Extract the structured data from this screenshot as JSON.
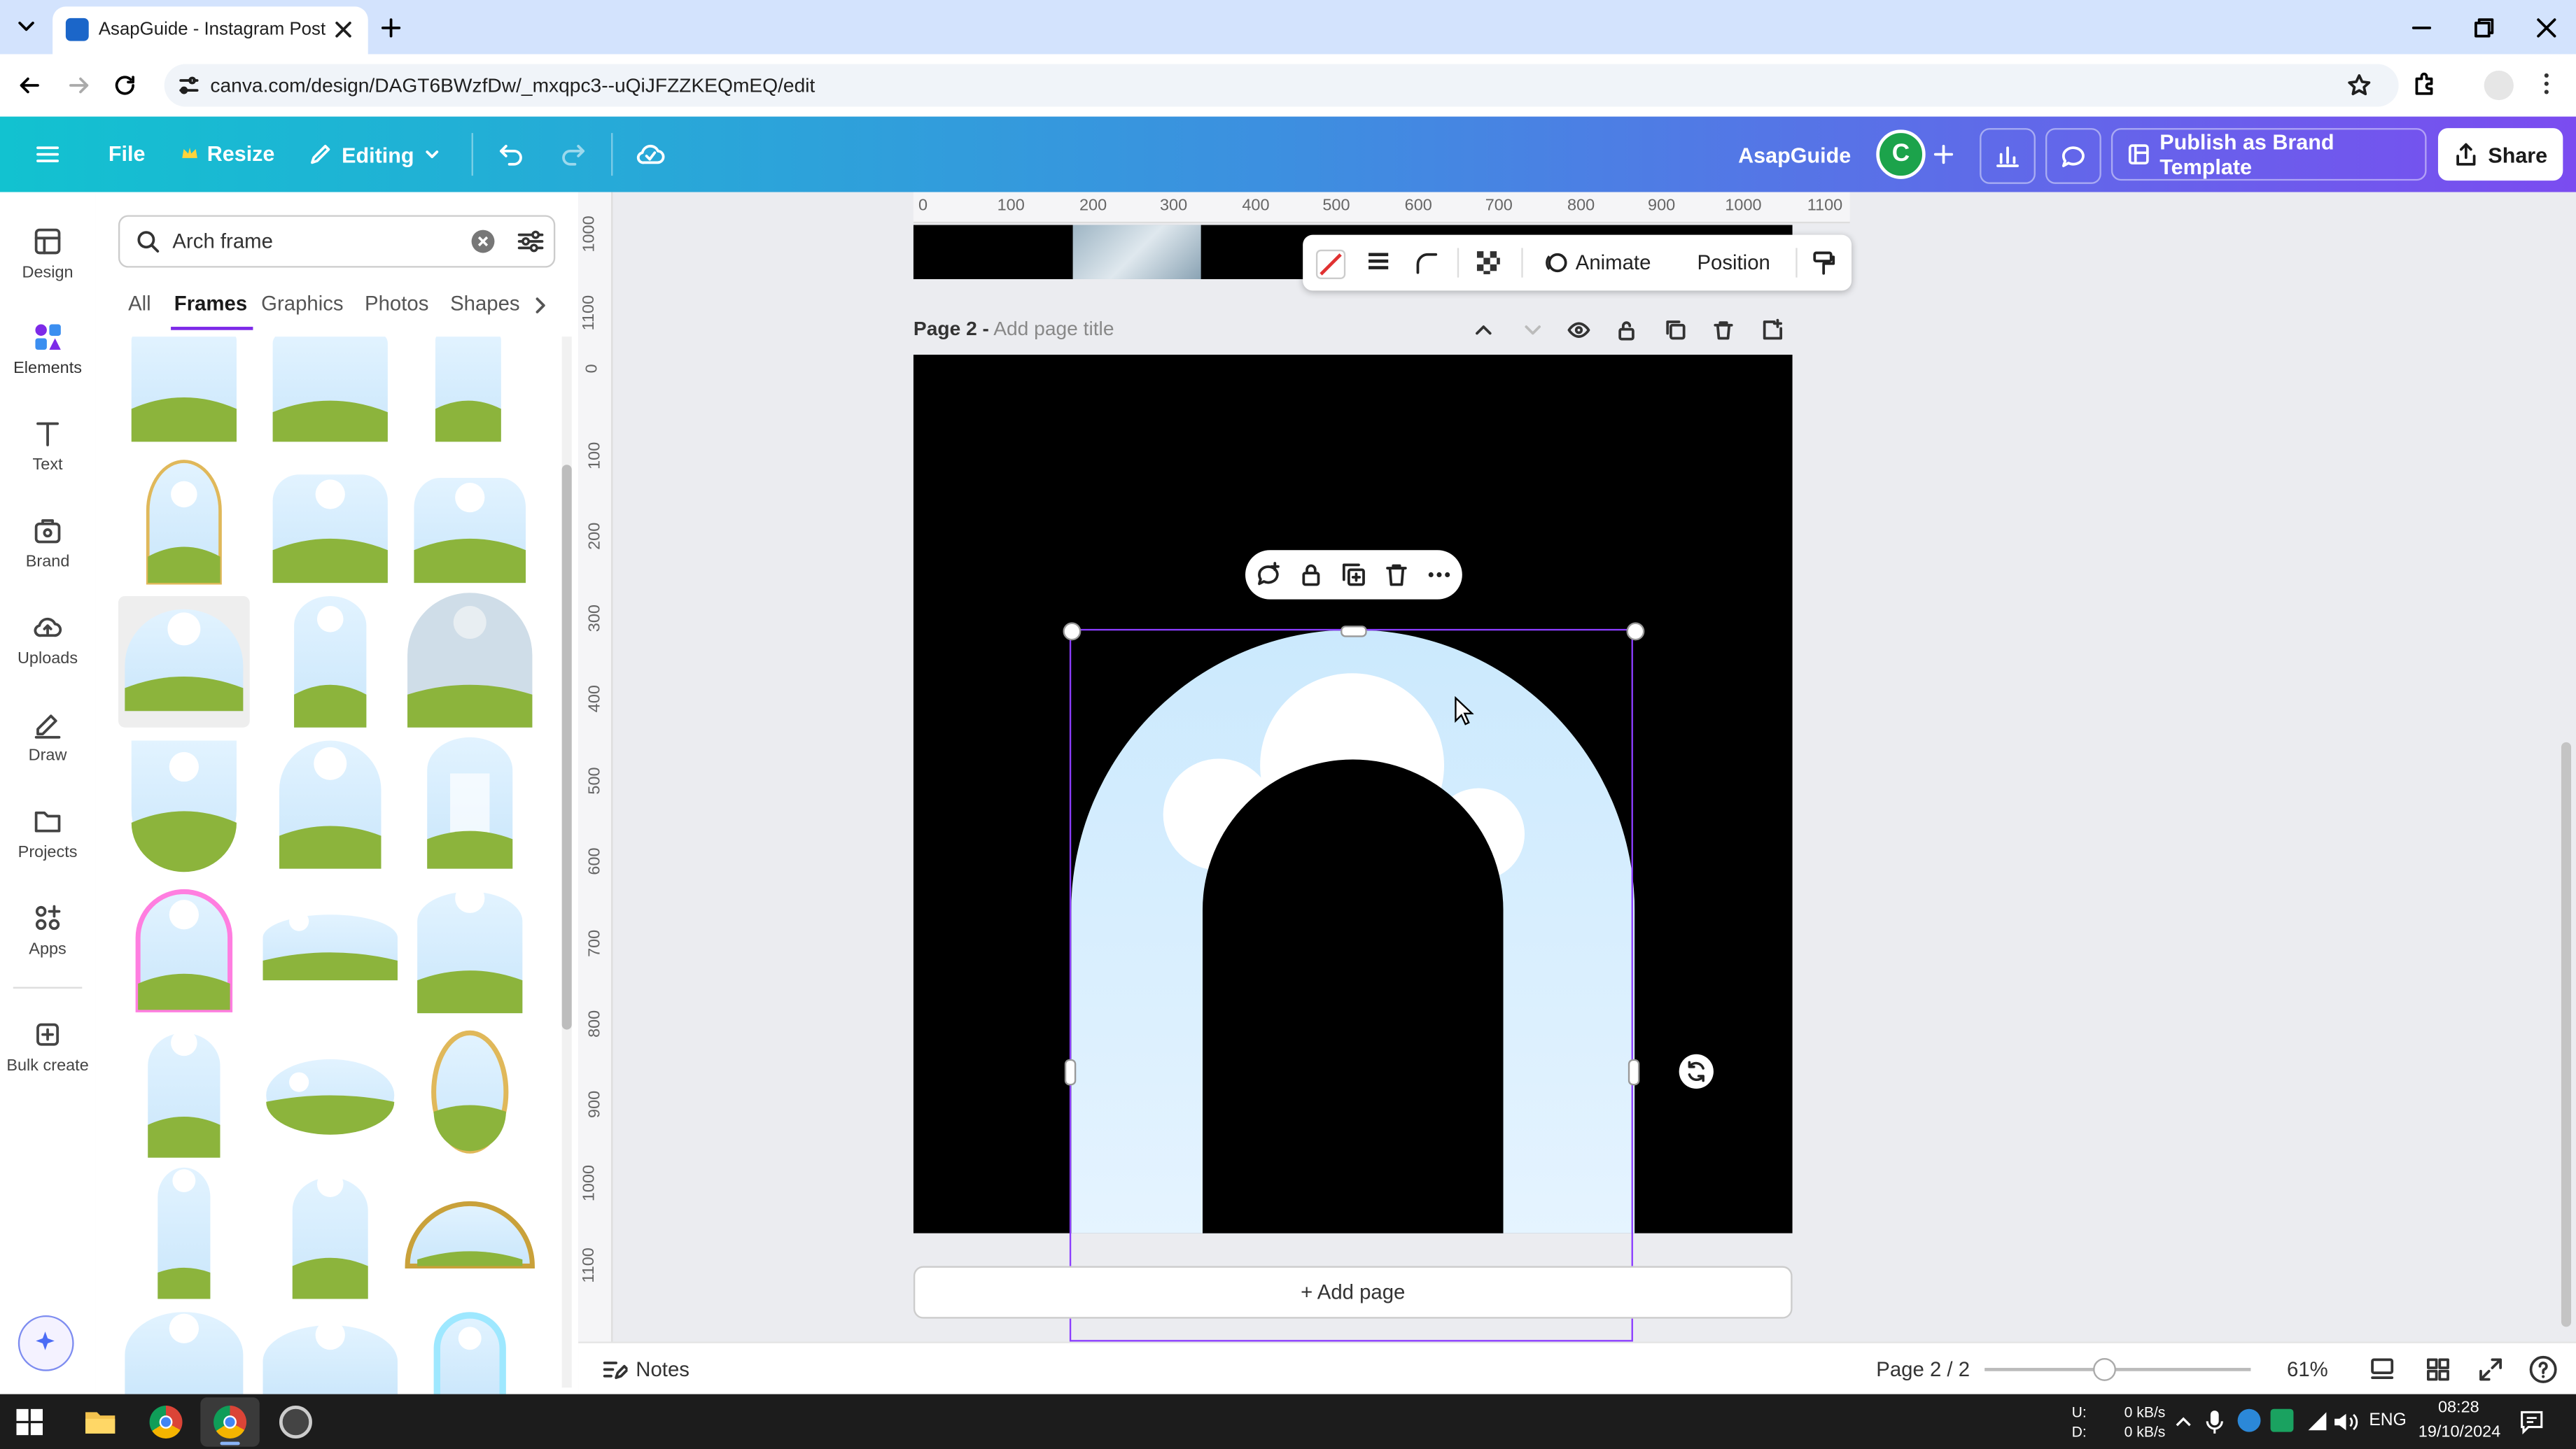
{
  "browser": {
    "tab_title": "AsapGuide - Instagram Post",
    "url": "canva.com/design/DAGT6BWzfDw/_mxqpc3--uQiJFZZKEQmEQ/edit"
  },
  "header": {
    "file": "File",
    "resize": "Resize",
    "editing": "Editing",
    "team_name": "AsapGuide",
    "avatar_letter": "C",
    "publish": "Publish as Brand Template",
    "share": "Share"
  },
  "rail": {
    "design": "Design",
    "elements": "Elements",
    "text": "Text",
    "brand": "Brand",
    "uploads": "Uploads",
    "draw": "Draw",
    "projects": "Projects",
    "apps": "Apps",
    "bulk_create": "Bulk create"
  },
  "panel": {
    "search_value": "Arch frame",
    "categories": {
      "all": "All",
      "frames": "Frames",
      "graphics": "Graphics",
      "photos": "Photos",
      "shapes": "Shapes"
    }
  },
  "toolbar": {
    "animate": "Animate",
    "position": "Position"
  },
  "rulers": {
    "horizontal": [
      "0",
      "100",
      "200",
      "300",
      "400",
      "500",
      "600",
      "700",
      "800",
      "900",
      "1000",
      "1100"
    ],
    "vertical": [
      "1000",
      "1100",
      "0",
      "100",
      "200",
      "300",
      "400",
      "500",
      "600",
      "700",
      "800",
      "900",
      "1000",
      "1100"
    ]
  },
  "page": {
    "label": "Page 2 -",
    "title_placeholder": "Add page title",
    "add_page": "+ Add page"
  },
  "footer": {
    "notes": "Notes",
    "page_indicator": "Page 2 / 2",
    "zoom": "61%",
    "zoom_level": 0.61
  },
  "taskbar": {
    "upload_label": "U:",
    "download_label": "D:",
    "upload_rate": "0 kB/s",
    "download_rate": "0 kB/s",
    "lang": "ENG",
    "time": "08:28",
    "date": "19/10/2024"
  },
  "colors": {
    "accent": "#7d2ae8",
    "selection": "#8b3dff",
    "sky": "#d6efff",
    "grass": "#8cb43c"
  }
}
